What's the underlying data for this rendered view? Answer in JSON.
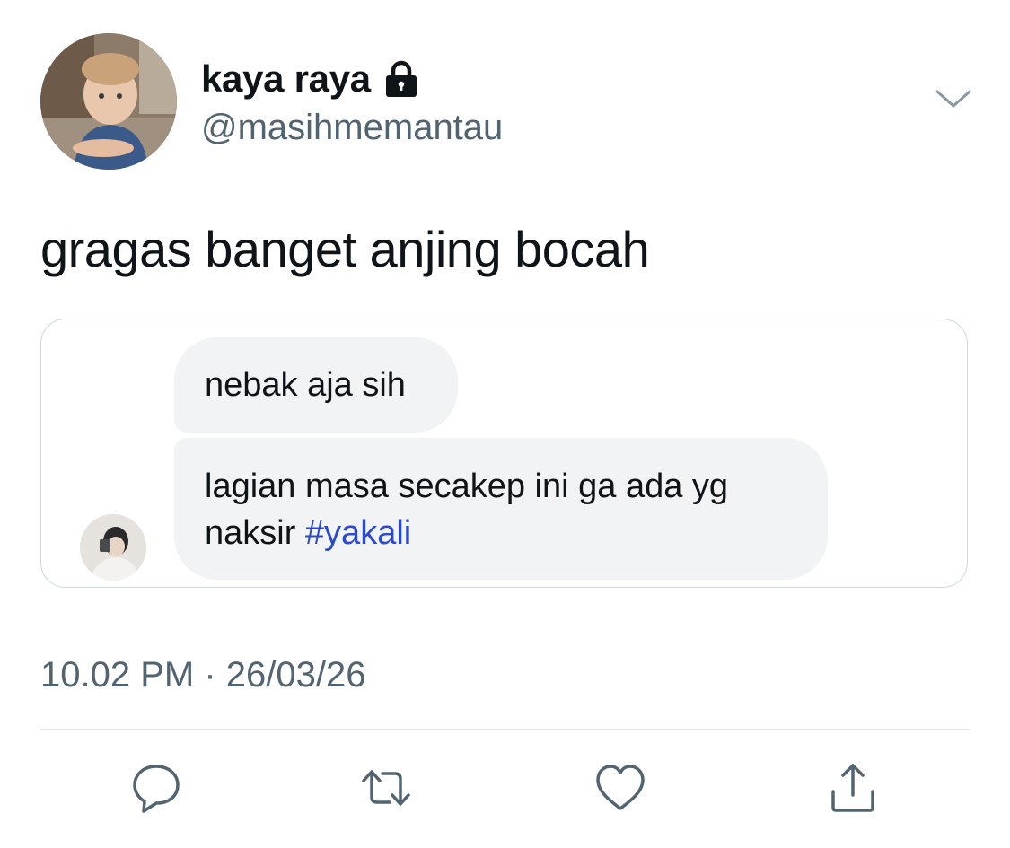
{
  "tweet": {
    "display_name": "kaya raya",
    "handle": "@masihmemantau",
    "text": "gragas banget anjing bocah",
    "timestamp": "10.02 PM · 26/03/26"
  },
  "quoted_chat": {
    "messages": [
      {
        "text": "nebak aja sih"
      },
      {
        "text_before_hashtag": "lagian masa secakep ini ga ada yg\nnaksir ",
        "hashtag": "#yakali"
      }
    ]
  },
  "icons": {
    "lock": "lock-icon",
    "chevron": "chevron-down-icon",
    "reply": "reply-icon",
    "retweet": "retweet-icon",
    "like": "heart-icon",
    "share": "share-icon"
  },
  "colors": {
    "text": "#0f1419",
    "secondary": "#536471",
    "hashtag": "#2b4acb",
    "bubble": "#f1f3f4",
    "border": "#cfd9de"
  }
}
